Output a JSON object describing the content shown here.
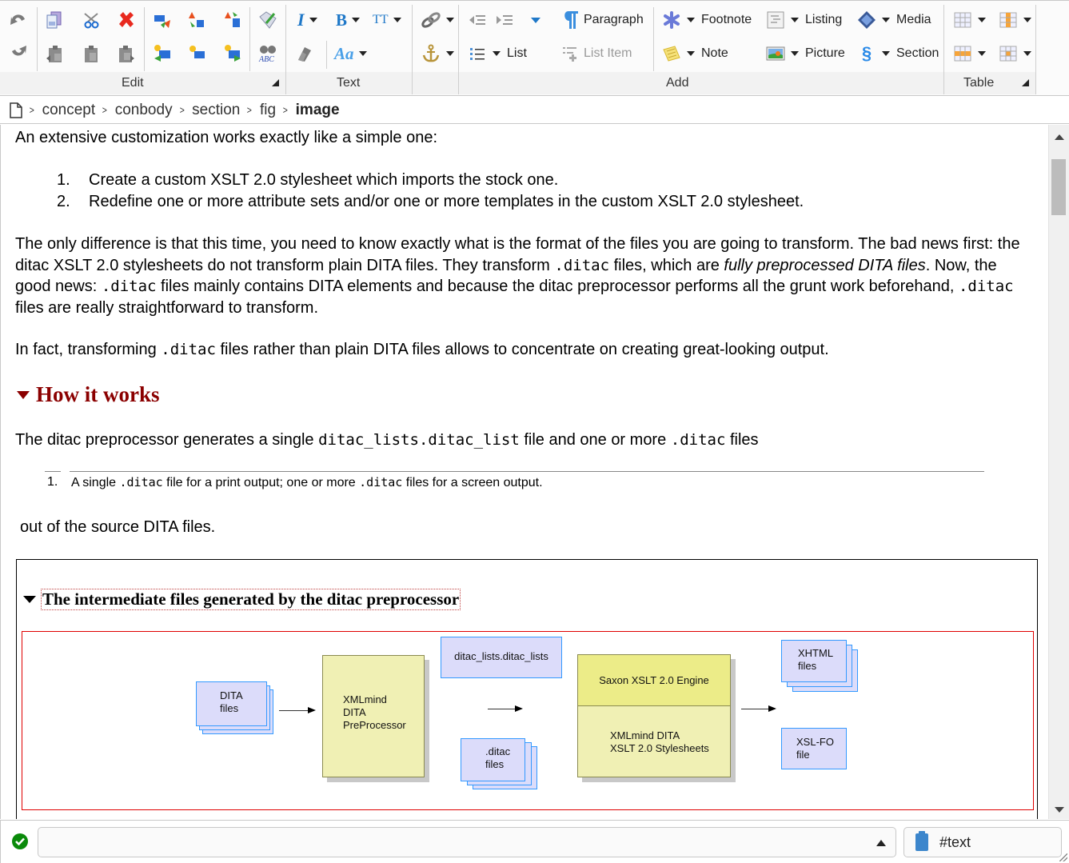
{
  "ribbon": {
    "groups": {
      "edit": {
        "label": "Edit"
      },
      "text": {
        "label": "Text"
      },
      "add": {
        "label": "Add"
      },
      "table": {
        "label": "Table"
      }
    },
    "edit_tools": [
      {
        "name": "undo-icon"
      },
      {
        "name": "redo-icon"
      },
      {
        "name": "copy-icon"
      },
      {
        "name": "cut-icon"
      },
      {
        "name": "delete-icon"
      },
      {
        "name": "paste-before-icon"
      },
      {
        "name": "paste-icon"
      },
      {
        "name": "paste-after-icon"
      },
      {
        "name": "replace-icon"
      },
      {
        "name": "convert-icon"
      },
      {
        "name": "wrap-icon"
      },
      {
        "name": "insert-before-icon"
      },
      {
        "name": "insert-icon"
      },
      {
        "name": "insert-after-icon"
      },
      {
        "name": "edit-attributes-icon"
      },
      {
        "name": "spell-check-icon"
      }
    ],
    "text_tools": {
      "italic_glyph": "I",
      "bold_glyph": "B",
      "monospace_glyph": "TT",
      "style_glyph": "Aa"
    },
    "add_tools": {
      "paragraph": "Paragraph",
      "list": "List",
      "list_item": "List Item",
      "footnote": "Footnote",
      "note": "Note",
      "listing": "Listing",
      "picture": "Picture",
      "media": "Media",
      "section": "Section"
    }
  },
  "breadcrumb": {
    "items": [
      "concept",
      "conbody",
      "section",
      "fig"
    ],
    "current": "image"
  },
  "document": {
    "intro": "An extensive customization works exactly like a simple one:",
    "steps": [
      {
        "num": "1.",
        "text": "Create a custom XSLT 2.0 stylesheet which imports the stock one."
      },
      {
        "num": "2.",
        "text": "Redefine one or more attribute sets and/or one or more templates in the custom XSLT 2.0 stylesheet."
      }
    ],
    "para2": {
      "t1": "The only difference is that this time, you need to know exactly what is the format of the files you are going to transform. The bad news first: the ditac XSLT 2.0 stylesheets do not transform plain DITA files. They transform ",
      "c1": ".ditac",
      "t2": " files, which are ",
      "em": "fully preprocessed DITA files",
      "t3": ". Now, the good news: ",
      "c2": ".ditac",
      "t4": " files mainly contains DITA elements and because the ditac preprocessor performs all the grunt work beforehand, ",
      "c3": ".ditac",
      "t5": " files are really straightforward to transform."
    },
    "para3": {
      "t1": "In fact, transforming ",
      "c1": ".ditac",
      "t2": " files rather than plain DITA files allows to concentrate on creating great-looking output."
    },
    "section_title": "How it works",
    "para4": {
      "t1": "The ditac preprocessor generates a single ",
      "c1": "ditac_lists.ditac_list",
      "t2": " file and one or more ",
      "c2": ".ditac",
      "t3": " files"
    },
    "footnote": {
      "num": "1.",
      "t1": "A single ",
      "c1": ".ditac",
      "t2": " file for a print output; one or more ",
      "c2": ".ditac",
      "t3": " files for a screen output."
    },
    "para5": "out of the source DITA files.",
    "figure": {
      "title": "The intermediate files generated by the ditac preprocessor",
      "diagram": {
        "dita_files": [
          "DITA",
          "files"
        ],
        "preprocessor": [
          "XMLmind",
          "DITA",
          "PreProcessor"
        ],
        "ditac_lists": "ditac_lists.ditac_lists",
        "ditac_files": [
          ".ditac",
          "files"
        ],
        "engine": "Saxon XSLT 2.0 Engine",
        "stylesheets": [
          "XMLmind DITA",
          "XSLT 2.0 Stylesheets"
        ],
        "xhtml_files": [
          "XHTML",
          "files"
        ],
        "xslfo_file": [
          "XSL-FO",
          "file"
        ]
      }
    }
  },
  "statusbar": {
    "message": "",
    "node_path": "#text"
  }
}
